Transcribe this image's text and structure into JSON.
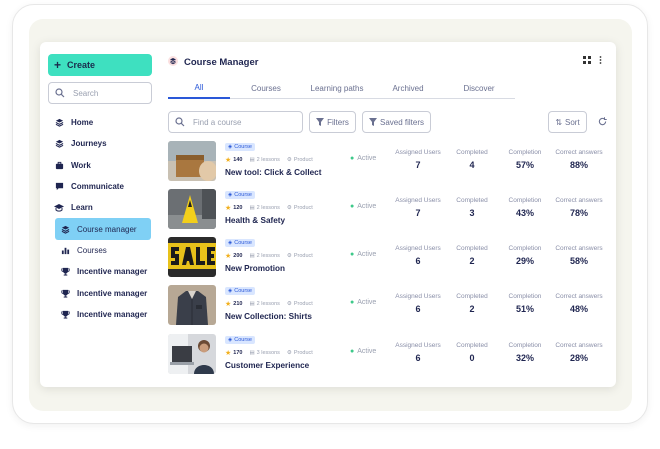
{
  "app": {
    "title": "Course Manager"
  },
  "sidebar": {
    "create_label": "Create",
    "search_placeholder": "Search",
    "items": [
      {
        "label": "Home",
        "icon": "layers-icon"
      },
      {
        "label": "Journeys",
        "icon": "layers-icon"
      },
      {
        "label": "Work",
        "icon": "briefcase-icon"
      },
      {
        "label": "Communicate",
        "icon": "chat-icon"
      },
      {
        "label": "Learn",
        "icon": "graduation-cap-icon"
      },
      {
        "label": "Course manager",
        "icon": "layers-icon"
      },
      {
        "label": "Courses",
        "icon": "bar-chart-icon"
      },
      {
        "label": "Incentive manager",
        "icon": "trophy-icon"
      },
      {
        "label": "Incentive manager",
        "icon": "trophy-icon"
      },
      {
        "label": "Incentive manager",
        "icon": "trophy-icon"
      }
    ]
  },
  "tabs": [
    "All",
    "Courses",
    "Learning paths",
    "Archived",
    "Discover"
  ],
  "filters": {
    "find_placeholder": "Find a course",
    "filters_label": "Filters",
    "saved_filters_label": "Saved filters",
    "sort_label": "Sort"
  },
  "columns": {
    "assigned": "Assigned Users",
    "completed": "Completed",
    "completion": "Completion",
    "correct": "Correct answers"
  },
  "courses": [
    {
      "badge": "Course",
      "points": "140",
      "lessons": "2 lessons",
      "category": "Product",
      "status": "Active",
      "name": "New tool: Click & Collect",
      "assigned": "7",
      "completed": "4",
      "completion": "57%",
      "correct": "88%"
    },
    {
      "badge": "Course",
      "points": "120",
      "lessons": "2 lessons",
      "category": "Product",
      "status": "Active",
      "name": "Health & Safety",
      "assigned": "7",
      "completed": "3",
      "completion": "43%",
      "correct": "78%"
    },
    {
      "badge": "Course",
      "points": "200",
      "lessons": "2 lessons",
      "category": "Product",
      "status": "Active",
      "name": "New Promotion",
      "assigned": "6",
      "completed": "2",
      "completion": "29%",
      "correct": "58%"
    },
    {
      "badge": "Course",
      "points": "210",
      "lessons": "2 lessons",
      "category": "Product",
      "status": "Active",
      "name": "New Collection: Shirts",
      "assigned": "6",
      "completed": "2",
      "completion": "51%",
      "correct": "48%"
    },
    {
      "badge": "Course",
      "points": "170",
      "lessons": "3 lessons",
      "category": "Product",
      "status": "Active",
      "name": "Customer Experience",
      "assigned": "6",
      "completed": "0",
      "completion": "32%",
      "correct": "28%"
    }
  ],
  "colors": {
    "accent": "#3ee0c0",
    "active_nav": "#7fd0f5",
    "tab_active": "#2a58d8"
  }
}
